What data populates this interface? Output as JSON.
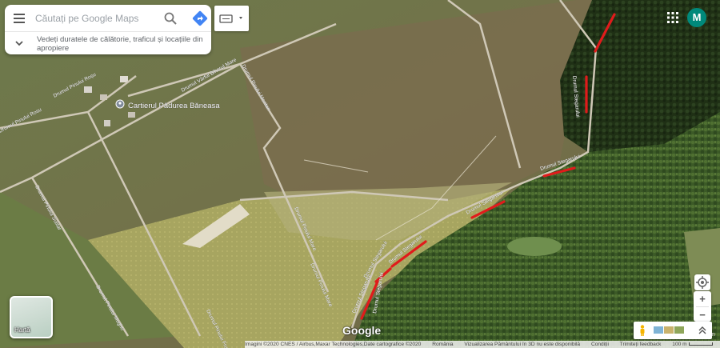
{
  "search": {
    "placeholder": "Căutați pe Google Maps",
    "promo_text": "Vedeți duratele de călătorie, traficul și locațiile din apropiere"
  },
  "header": {
    "avatar_letter": "M"
  },
  "map": {
    "type": "satellite",
    "place_label": "Cartierul Pădurea Băneasa",
    "road_labels": [
      "Drumul Pinului Roșu",
      "Drumul Vârful Bihorul Mare",
      "Drumul Pinului Rosu",
      "Drumul Pinului Sulitar",
      "Drumul Pinului Mugho",
      "Drumul Pinului Montan",
      "Drumul Pinului Mare",
      "Drumul Pinului Mare",
      "Drumul Pinului Frunză",
      "Drumul Stegarului",
      "Drumul Stegarului",
      "Drumul Stegarului",
      "Drumul Stegarului",
      "Drumul Stegarului",
      "Drumul Stegarului",
      "Drumul Stegarului"
    ],
    "edge_label": "Lăn",
    "highlight_color": "#e01b1b",
    "highlight_count": 7
  },
  "controls": {
    "layer_label": "Hartă",
    "logo_text": "Google",
    "zoom_in_label": "+",
    "zoom_out_label": "−"
  },
  "attribution": {
    "imagery": "Imagini ©2020 CNES / Airbus,Maxar Technologies,Date cartografice ©2020",
    "country": "România",
    "view_3d": "Vizualizarea Pământului în 3D nu este disponibilă",
    "terms": "Condiții",
    "feedback": "Trimiteți feedback",
    "scale": "100 m"
  },
  "colors": {
    "avatar": "#00897b",
    "route_marks": "#e01b1b",
    "direction_icon": "#4285f4"
  }
}
